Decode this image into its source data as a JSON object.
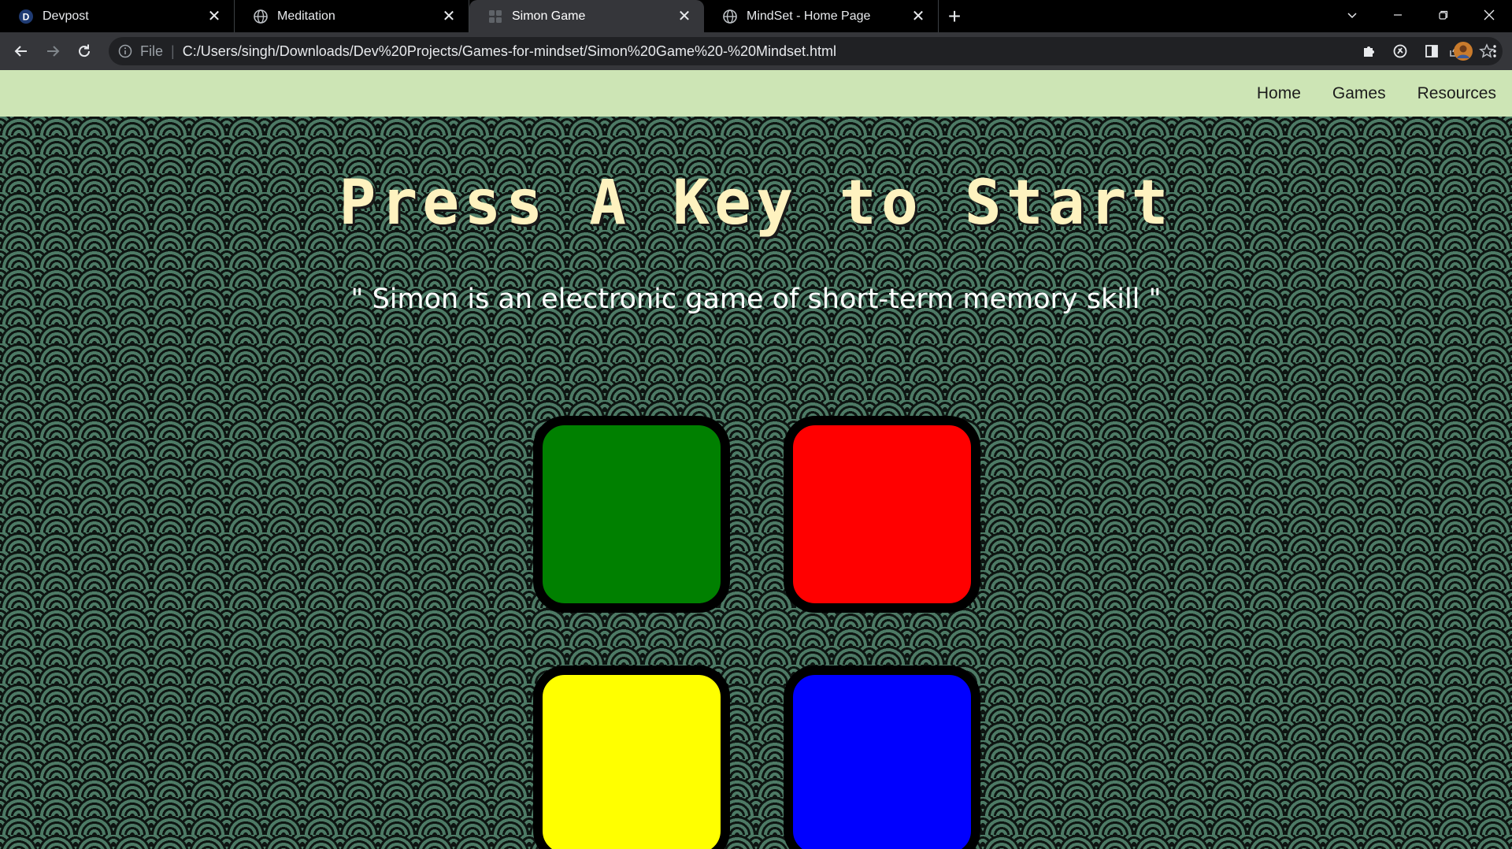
{
  "browser": {
    "tabs": [
      {
        "title": "Devpost",
        "favicon": "devpost-logo-icon",
        "active": false
      },
      {
        "title": "Meditation",
        "favicon": "globe-icon",
        "active": false
      },
      {
        "title": "Simon Game",
        "favicon": "simon-favicon-icon",
        "active": true
      },
      {
        "title": "MindSet - Home Page",
        "favicon": "globe-icon",
        "active": false
      }
    ],
    "devpost_letter": "D",
    "address": {
      "scheme": "File",
      "url": "C:/Users/singh/Downloads/Dev%20Projects/Games-for-mindset/Simon%20Game%20-%20Mindset.html"
    }
  },
  "site_nav": {
    "links": [
      "Home",
      "Games",
      "Resources"
    ],
    "background": "#cde5b5"
  },
  "game": {
    "title": "Press A Key to Start",
    "subtitle": "\" Simon is an electronic game of short-term memory skill \"",
    "title_color": "#fef2bf",
    "buttons": [
      {
        "id": "green",
        "color": "#008000"
      },
      {
        "id": "red",
        "color": "#ff0000"
      },
      {
        "id": "yellow",
        "color": "#ffff00"
      },
      {
        "id": "blue",
        "color": "#0000ff"
      }
    ]
  }
}
